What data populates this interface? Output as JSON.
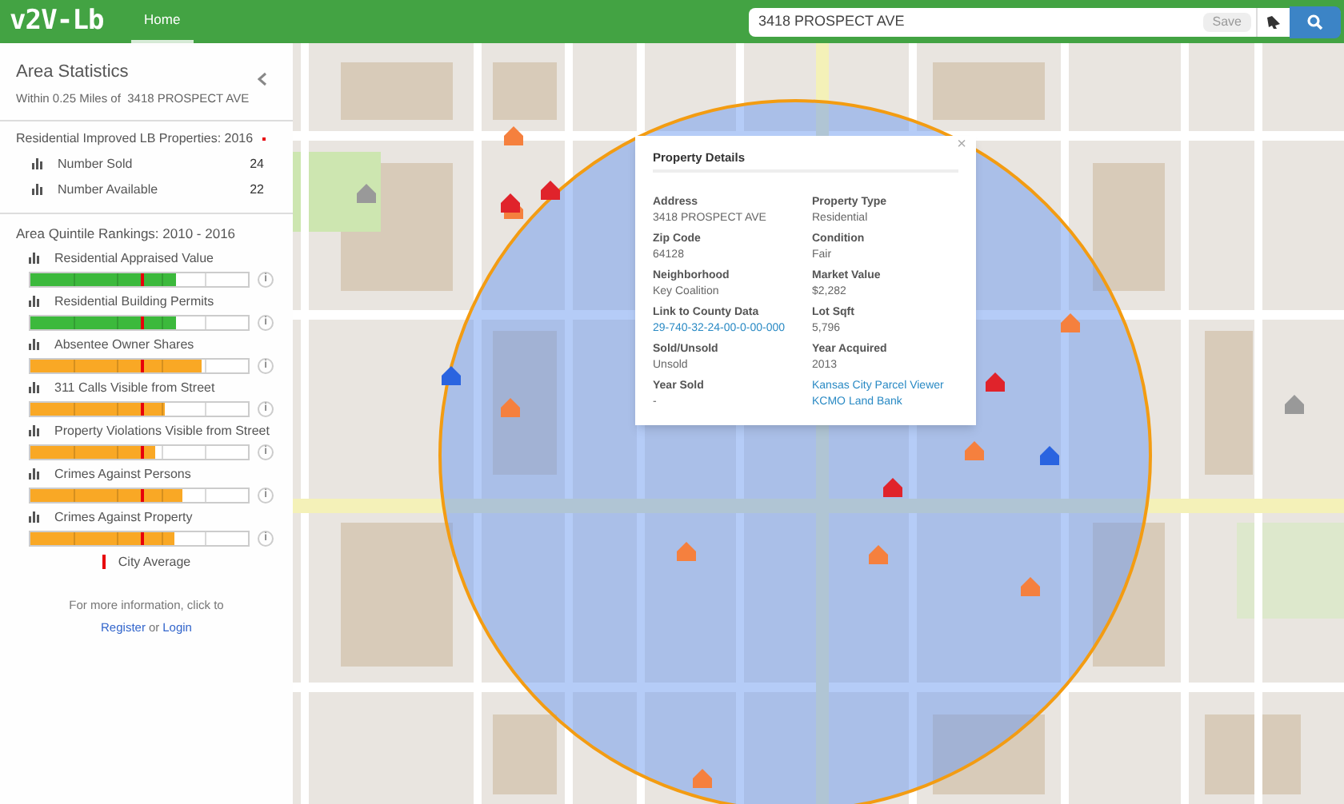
{
  "header": {
    "logo": "v2V-Lb",
    "tabs": [
      {
        "label": "Home",
        "selected": true
      }
    ],
    "search": {
      "value": "3418 PROSPECT AVE",
      "save_button": "Save"
    }
  },
  "sidebar": {
    "title": "Area Statistics",
    "subtitle": "Within 0.25 Miles of  3418 PROSPECT AVE",
    "properties": {
      "heading": "Residential Improved LB Properties: 2016",
      "rows": [
        {
          "label": "Number Sold",
          "value": "24"
        },
        {
          "label": "Number Available",
          "value": "22"
        }
      ]
    },
    "rankings": {
      "heading": "Area Quintile Rankings: 2010 - 2016",
      "items": [
        {
          "label": "Residential Appraised Value",
          "level": 0.67,
          "color": "#3cb93c",
          "info": "i"
        },
        {
          "label": "Residential Building Permits",
          "level": 0.67,
          "color": "#3cb93c",
          "info": "i"
        },
        {
          "label": "Absentee Owner Shares",
          "level": 0.79,
          "color": "#f9a825",
          "info": "i"
        },
        {
          "label": "311 Calls Visible from Street",
          "level": 0.62,
          "color": "#f9a825",
          "info": "i"
        },
        {
          "label": "Property Violations Visible from Street",
          "level": 0.57,
          "color": "#f9a825",
          "info": "i"
        },
        {
          "label": "Crimes Against Persons",
          "level": 0.7,
          "color": "#f9a825",
          "info": "i"
        },
        {
          "label": "Crimes Against Property",
          "level": 0.66,
          "color": "#f9a825",
          "info": "i"
        }
      ]
    },
    "legend": "City Average",
    "more_info": "For more information, click to",
    "register": "Register",
    "or": "or",
    "login": "Login"
  },
  "popup": {
    "title": "Property Details",
    "close": "×",
    "columns": [
      [
        {
          "kind": "field",
          "label": "Address",
          "value": "3418 PROSPECT AVE"
        },
        {
          "kind": "field",
          "label": "Zip Code",
          "value": "64128"
        },
        {
          "kind": "field",
          "label": "Neighborhood",
          "value": "Key Coalition"
        },
        {
          "kind": "link",
          "label": "Link to County Data",
          "value": "29-740-32-24-00-0-00-000"
        },
        {
          "kind": "field",
          "label": "Sold/Unsold",
          "value": "Unsold"
        },
        {
          "kind": "field",
          "label": "Year Sold",
          "value": "-"
        }
      ],
      [
        {
          "kind": "field",
          "label": "Property Type",
          "value": "Residential"
        },
        {
          "kind": "field",
          "label": "Condition",
          "value": "Fair"
        },
        {
          "kind": "field",
          "label": "Market Value",
          "value": "$2,282"
        },
        {
          "kind": "field",
          "label": "Lot Sqft",
          "value": "5,796"
        },
        {
          "kind": "field",
          "label": "Year Acquired",
          "value": "2013"
        },
        {
          "kind": "links",
          "links": [
            "Kansas City Parcel Viewer",
            "KCMO Land Bank"
          ]
        }
      ]
    ]
  }
}
